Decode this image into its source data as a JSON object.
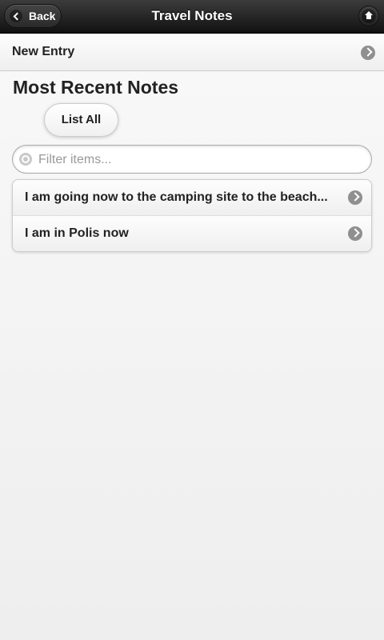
{
  "header": {
    "title": "Travel Notes",
    "back_label": "Back",
    "back_icon": "chevron-left-icon",
    "home_icon": "home-icon"
  },
  "new_entry": {
    "label": "New Entry",
    "icon": "chevron-right-icon"
  },
  "section": {
    "title": "Most Recent Notes"
  },
  "list_all": {
    "label": "List All"
  },
  "filter": {
    "placeholder": "Filter items...",
    "value": "",
    "icon": "search-icon"
  },
  "notes": [
    {
      "label": "I am going now to the camping site to the beach..."
    },
    {
      "label": "I am in Polis now"
    }
  ]
}
